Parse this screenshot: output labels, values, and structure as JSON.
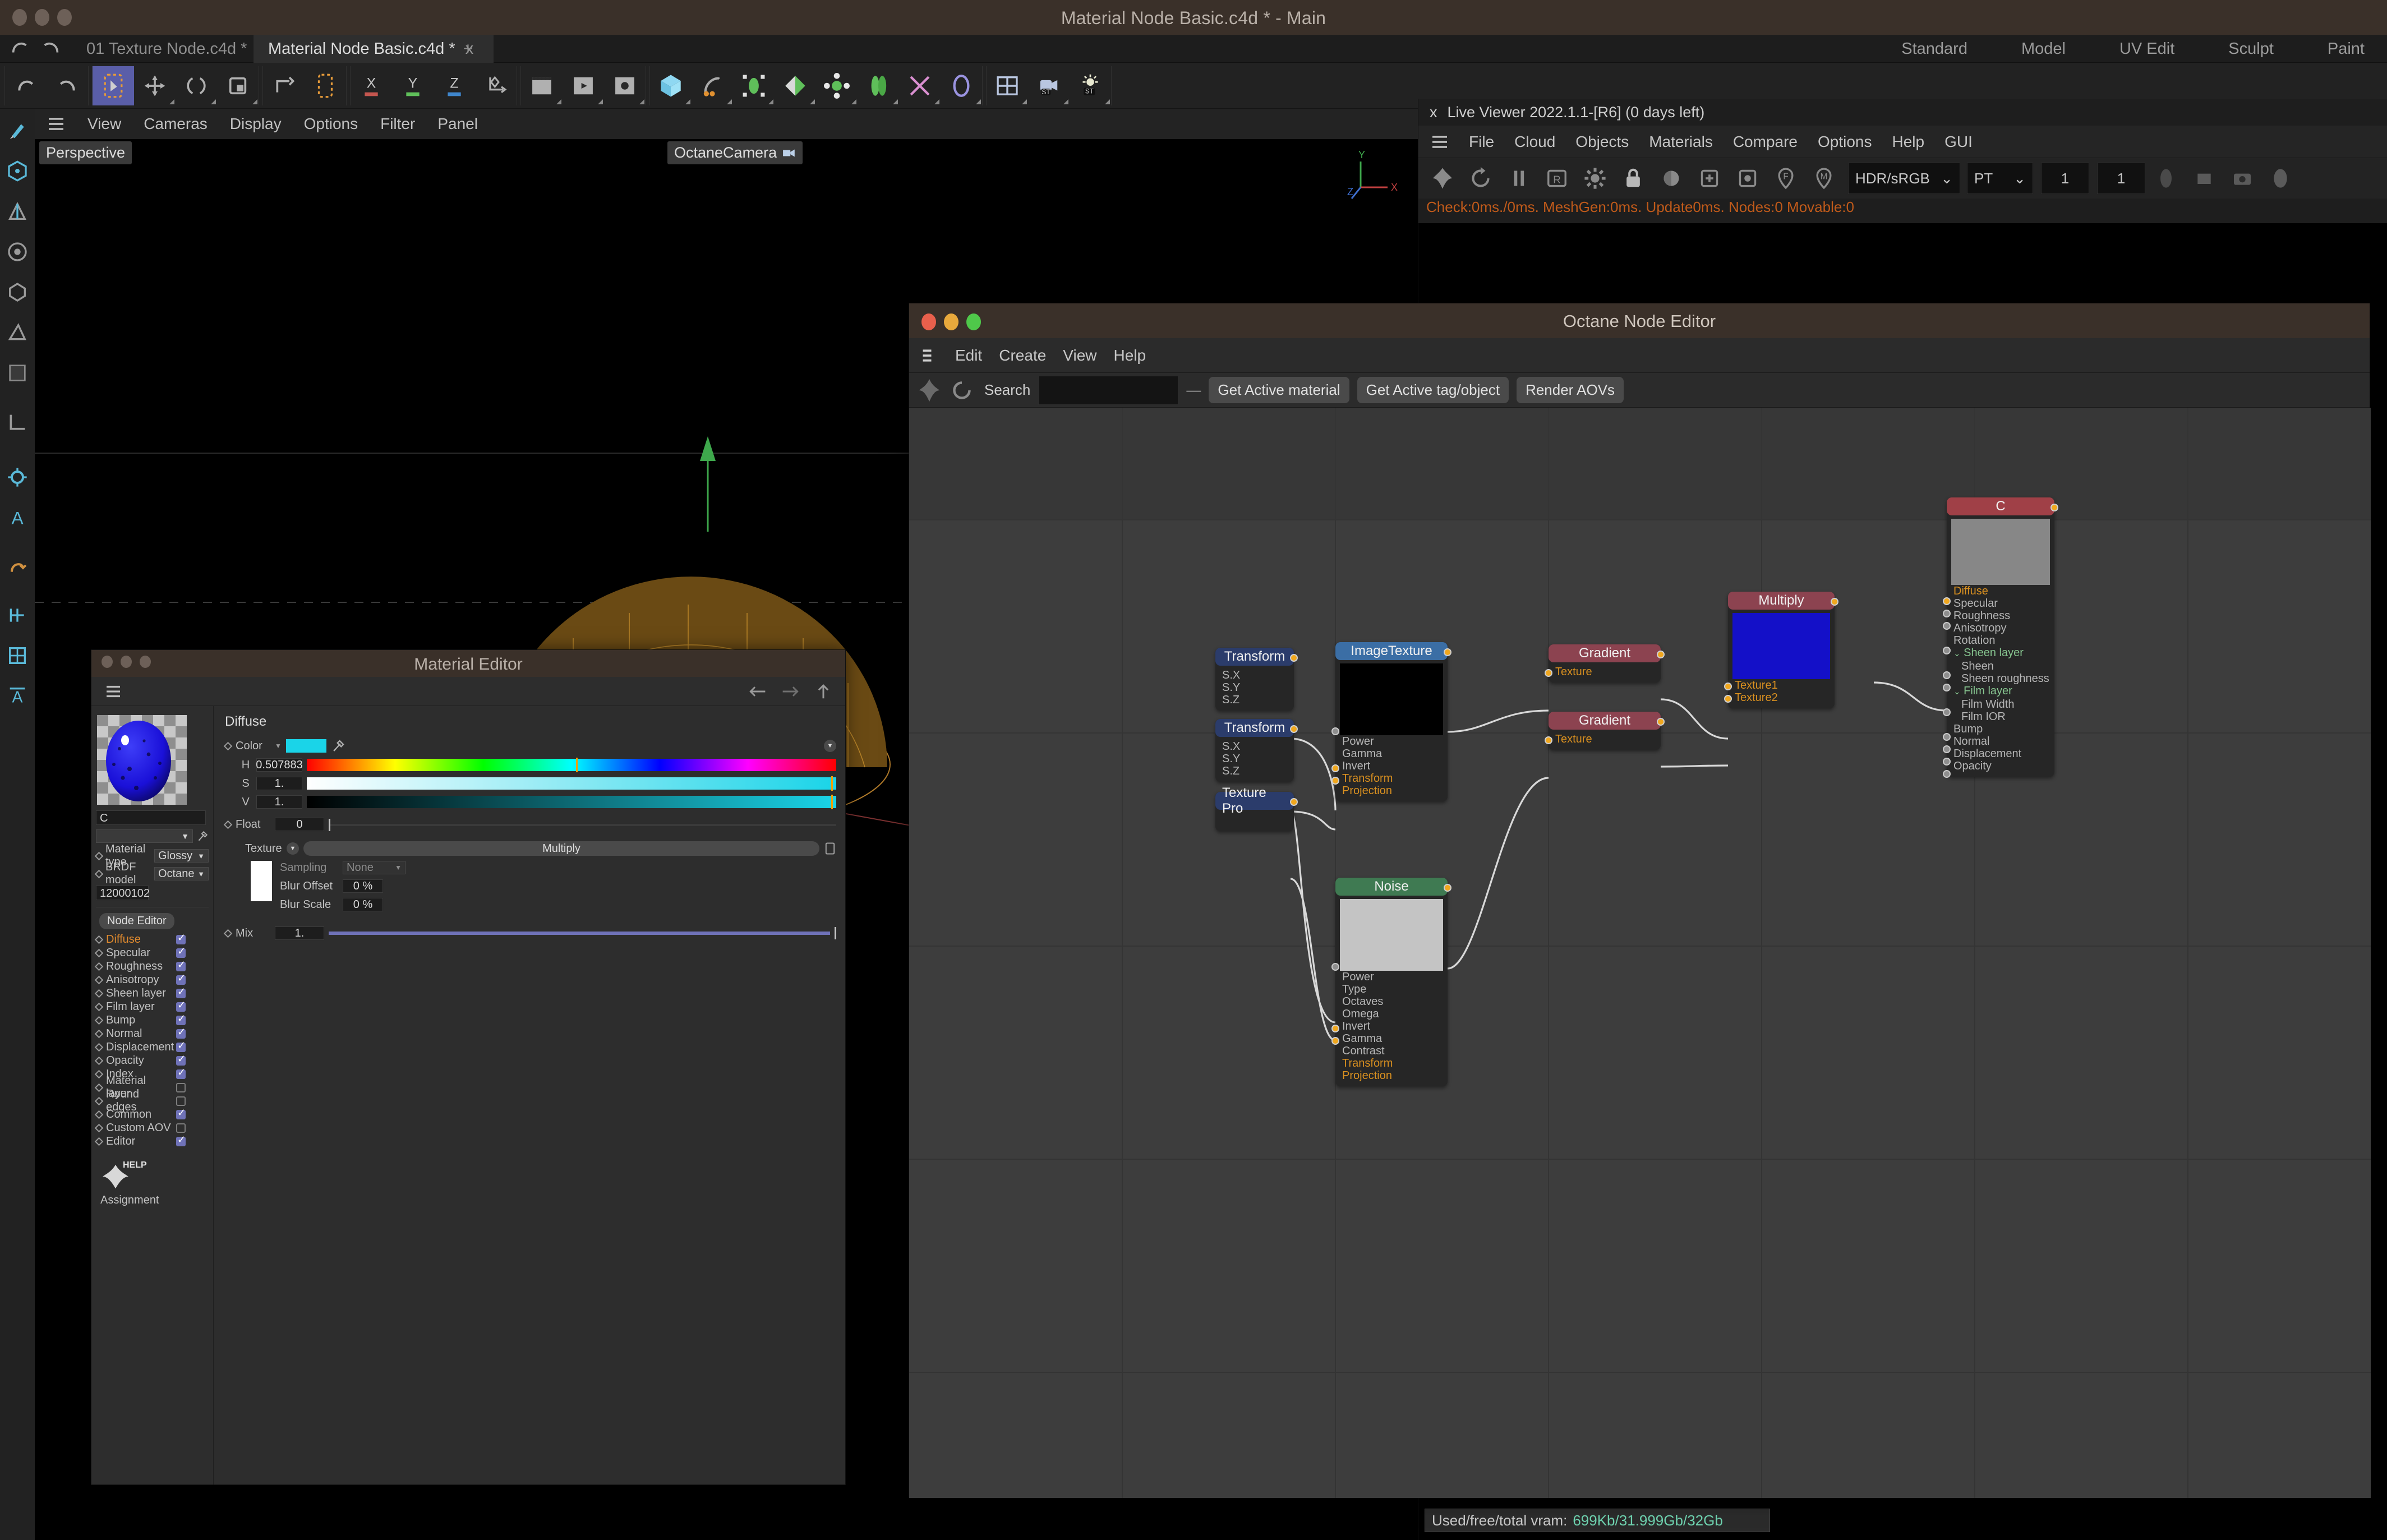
{
  "window": {
    "title": "Material Node Basic.c4d * - Main"
  },
  "doc_tabs": [
    {
      "label": "01 Texture Node.c4d *",
      "active": false
    },
    {
      "label": "Material Node Basic.c4d *",
      "active": true
    }
  ],
  "doc_tab_close": "x",
  "doc_tab_add": "+",
  "layout_tabs": [
    "Standard",
    "Model",
    "UV Edit",
    "Sculpt",
    "Paint"
  ],
  "viewport": {
    "menu": [
      "View",
      "Cameras",
      "Display",
      "Options",
      "Filter",
      "Panel"
    ],
    "projection_label": "Perspective",
    "camera_label": "OctaneCamera",
    "axis_y": "Y",
    "axis_x": "X",
    "axis_z": "Z"
  },
  "live_viewer": {
    "close_label": "x",
    "title": "Live Viewer 2022.1.1-[R6] (0 days left)",
    "menu": [
      "File",
      "Cloud",
      "Objects",
      "Materials",
      "Compare",
      "Options",
      "Help",
      "GUI"
    ],
    "colorspace": "HDR/sRGB",
    "kernel": "PT",
    "num1": "1",
    "num2": "1",
    "status": "Check:0ms./0ms. MeshGen:0ms. Update0ms. Nodes:0 Movable:0",
    "vram_label": "Used/free/total vram:",
    "vram_used": "699Kb",
    "vram_free": "31.999Gb",
    "vram_total": "32Gb"
  },
  "material_editor": {
    "title": "Material Editor",
    "material_name": "C",
    "material_id": "12000102",
    "fields": [
      {
        "label": "Material type",
        "value": "Glossy"
      },
      {
        "label": "BRDF model",
        "value": "Octane"
      }
    ],
    "node_editor_button": "Node Editor",
    "channels": [
      {
        "label": "Diffuse",
        "checked": true,
        "active": true
      },
      {
        "label": "Specular",
        "checked": true,
        "active": false
      },
      {
        "label": "Roughness",
        "checked": true,
        "active": false
      },
      {
        "label": "Anisotropy",
        "checked": true,
        "active": false
      },
      {
        "label": "Sheen layer",
        "checked": true,
        "active": false
      },
      {
        "label": "Film layer",
        "checked": true,
        "active": false
      },
      {
        "label": "Bump",
        "checked": true,
        "active": false
      },
      {
        "label": "Normal",
        "checked": true,
        "active": false
      },
      {
        "label": "Displacement",
        "checked": true,
        "active": false
      },
      {
        "label": "Opacity",
        "checked": true,
        "active": false
      },
      {
        "label": "Index",
        "checked": true,
        "active": false
      },
      {
        "label": "Material layer",
        "checked": false,
        "active": false
      },
      {
        "label": "Round edges",
        "checked": false,
        "active": false
      },
      {
        "label": "Common",
        "checked": true,
        "active": false
      },
      {
        "label": "Custom AOV",
        "checked": false,
        "active": false
      },
      {
        "label": "Editor",
        "checked": true,
        "active": false
      }
    ],
    "help_label": "HELP",
    "assignment_label": "Assignment",
    "properties": {
      "heading": "Diffuse",
      "color_label": "Color",
      "color_hex": "#1ad4e8",
      "hsv": [
        {
          "label": "H",
          "value": "0.507883"
        },
        {
          "label": "S",
          "value": "1."
        },
        {
          "label": "V",
          "value": "1."
        }
      ],
      "float_label": "Float",
      "float_value": "0",
      "texture_label": "Texture",
      "texture_value": "Multiply",
      "sampling_label": "Sampling",
      "sampling_value": "None",
      "blur_offset_label": "Blur Offset",
      "blur_offset_value": "0 %",
      "blur_scale_label": "Blur Scale",
      "blur_scale_value": "0 %",
      "mix_label": "Mix",
      "mix_value": "1."
    }
  },
  "octane_node_editor": {
    "title": "Octane Node Editor",
    "menu": [
      "Edit",
      "Create",
      "View",
      "Help"
    ],
    "search_label": "Search",
    "search_value": "",
    "buttons": [
      "Get Active material",
      "Get Active tag/object",
      "Render AOVs"
    ],
    "nodes": {
      "transform1": {
        "title": "Transform",
        "params": [
          "S.X",
          "S.Y",
          "S.Z"
        ]
      },
      "transform2": {
        "title": "Transform",
        "params": [
          "S.X",
          "S.Y",
          "S.Z"
        ]
      },
      "texture_projection": {
        "title": "Texture Pro"
      },
      "image_texture": {
        "title": "ImageTexture",
        "params": [
          "Power",
          "Gamma",
          "Invert",
          "Transform",
          "Projection"
        ],
        "highlighted": [
          "Transform",
          "Projection"
        ]
      },
      "noise": {
        "title": "Noise",
        "params": [
          "Power",
          "Type",
          "Octaves",
          "Omega",
          "Invert",
          "Gamma",
          "Contrast",
          "Transform",
          "Projection"
        ],
        "highlighted": [
          "Transform",
          "Projection"
        ]
      },
      "gradient1": {
        "title": "Gradient",
        "params": [
          "Texture"
        ]
      },
      "gradient2": {
        "title": "Gradient",
        "params": [
          "Texture"
        ]
      },
      "multiply": {
        "title": "Multiply",
        "params": [
          "Texture1",
          "Texture2"
        ]
      },
      "material": {
        "title": "C",
        "params": [
          "Diffuse",
          "Specular",
          "Roughness",
          "Anisotropy",
          "Rotation",
          "Sheen layer",
          "Sheen",
          "Sheen roughness",
          "Film layer",
          "Film Width",
          "Film IOR",
          "Bump",
          "Normal",
          "Displacement",
          "Opacity"
        ],
        "diffuse_label": "Diffuse",
        "group_labels": [
          "Sheen layer",
          "Film layer"
        ]
      }
    }
  },
  "colors": {
    "accent_orange": "#e08a2e",
    "node_blue": "#3b6ea5",
    "node_navy": "#2b3c6b",
    "node_green": "#3f7a52",
    "node_maroon": "#8c4350",
    "node_red": "#a04047",
    "check_blue": "#6f72b8",
    "cyan": "#1ad4e8",
    "vram_green": "#6fd3b0",
    "status_orange": "#c05a1a"
  }
}
